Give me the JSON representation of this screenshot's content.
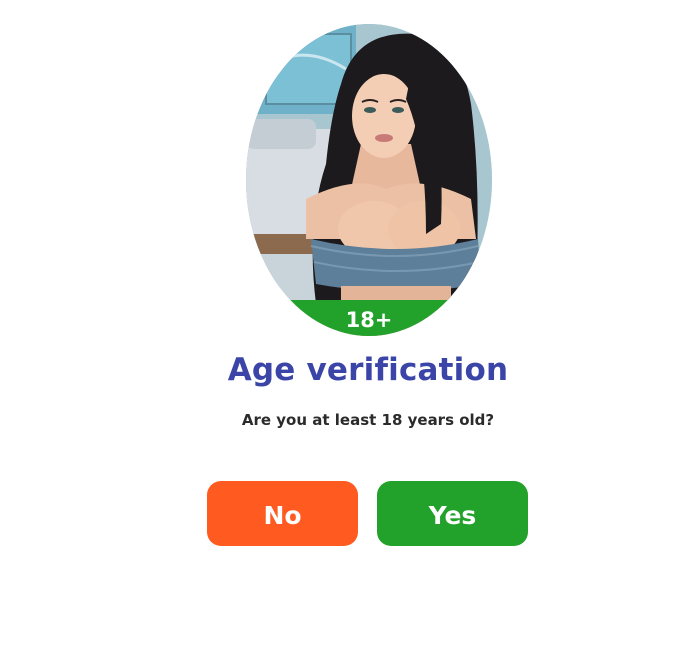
{
  "dialog": {
    "badge_text": "18+",
    "title": "Age verification",
    "question": "Are you at least 18 years old?",
    "no_label": "No",
    "yes_label": "Yes"
  },
  "colors": {
    "title": "#3b45a8",
    "badge_bg": "#23a22b",
    "no_button": "#ff5a1f",
    "yes_button": "#22a22a"
  }
}
